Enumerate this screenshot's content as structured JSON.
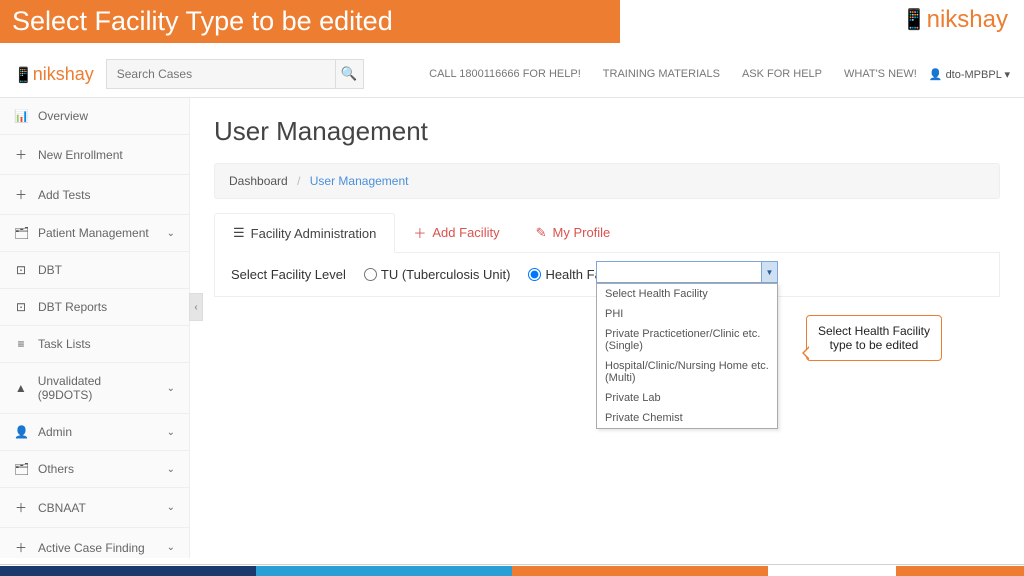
{
  "banner": {
    "title": "Select Facility Type to be edited"
  },
  "brand": "nikshay",
  "search": {
    "placeholder": "Search Cases"
  },
  "topnav": {
    "call": "CALL 1800116666 FOR HELP!",
    "training": "TRAINING MATERIALS",
    "ask": "ASK FOR HELP",
    "whatsnew": "WHAT'S NEW!",
    "user": "dto-MPBPL"
  },
  "sidebar": {
    "items": [
      {
        "icon": "📊",
        "label": "Overview",
        "chev": ""
      },
      {
        "icon": "＋",
        "label": "New Enrollment",
        "chev": ""
      },
      {
        "icon": "＋",
        "label": "Add Tests",
        "chev": ""
      },
      {
        "icon": "🗂",
        "label": "Patient Management",
        "chev": "⌄"
      },
      {
        "icon": "⊡",
        "label": "DBT",
        "chev": ""
      },
      {
        "icon": "⊡",
        "label": "DBT Reports",
        "chev": ""
      },
      {
        "icon": "≡",
        "label": "Task Lists",
        "chev": ""
      },
      {
        "icon": "▲",
        "label": "Unvalidated (99DOTS)",
        "chev": "⌄"
      },
      {
        "icon": "👤",
        "label": "Admin",
        "chev": "⌄"
      },
      {
        "icon": "🗂",
        "label": "Others",
        "chev": "⌄"
      },
      {
        "icon": "＋",
        "label": "CBNAAT",
        "chev": "⌄"
      },
      {
        "icon": "＋",
        "label": "Active Case Finding",
        "chev": "⌄"
      }
    ]
  },
  "main": {
    "title": "User Management",
    "breadcrumb": {
      "root": "Dashboard",
      "current": "User Management"
    },
    "tabs": {
      "admin": "Facility Administration",
      "add": "Add Facility",
      "profile": "My Profile"
    },
    "facility": {
      "label": "Select Facility Level",
      "opt_tu": "TU (Tuberculosis Unit)",
      "opt_hf": "Health Facility"
    }
  },
  "dropdown": {
    "options": [
      "Select Health Facility",
      "PHI",
      "Private Practicetioner/Clinic etc.(Single)",
      "Hospital/Clinic/Nursing Home etc.(Multi)",
      "Private Lab",
      "Private Chemist"
    ]
  },
  "callout": {
    "text": "Select Health Facility type to be edited"
  }
}
